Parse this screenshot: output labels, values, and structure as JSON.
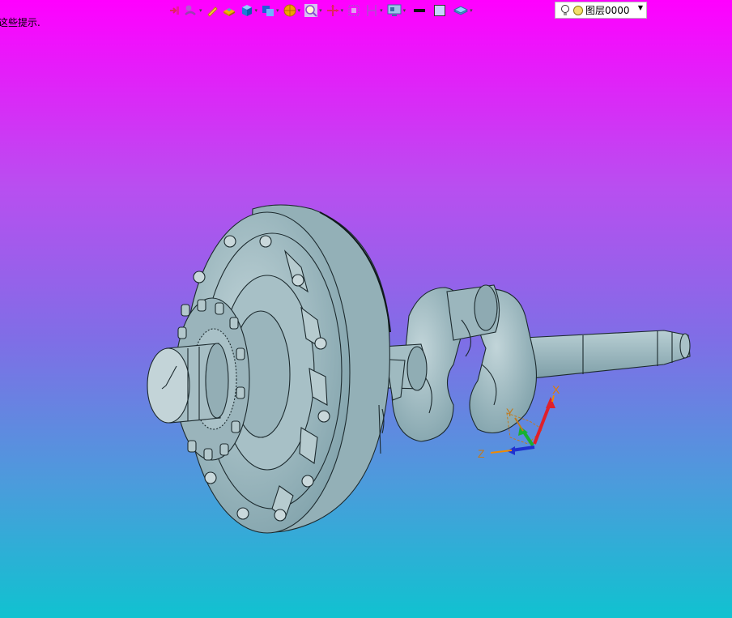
{
  "hint_text": "这些提示.",
  "toolbar": {
    "items": [
      {
        "icon": "snap-point-icon",
        "color": "#e0245e"
      },
      {
        "icon": "sketch-tool-icon",
        "color": "#9a3fb0"
      },
      {
        "icon": "pencil-icon",
        "color": "#d4a017"
      },
      {
        "icon": "extrude-icon",
        "color": "#e5a400"
      },
      {
        "icon": "cube-icon",
        "color": "#1e7fd6"
      },
      {
        "icon": "boolean-icon",
        "color": "#1e5fd6"
      },
      {
        "icon": "sphere-icon",
        "color": "#f2a100"
      },
      {
        "icon": "zoom-icon",
        "color": "#8a4bd0"
      },
      {
        "icon": "move-axis-icon",
        "color": "#e0245e"
      },
      {
        "icon": "frame-icon",
        "color": "#b04bd0"
      },
      {
        "icon": "dimension-icon",
        "color": "#b04bd0"
      },
      {
        "icon": "display-settings-icon",
        "color": "#3a6ea5"
      },
      {
        "icon": "line-weight-icon",
        "color": "#111111"
      },
      {
        "icon": "color-swatch-icon",
        "color": "#c8d2ff"
      },
      {
        "icon": "layer-stack-icon",
        "color": "#4aa0d8"
      }
    ]
  },
  "layer_selector": {
    "value": "图层0000"
  },
  "triad": {
    "x_label": "X",
    "y_label": "Y",
    "z_label": "Z"
  }
}
